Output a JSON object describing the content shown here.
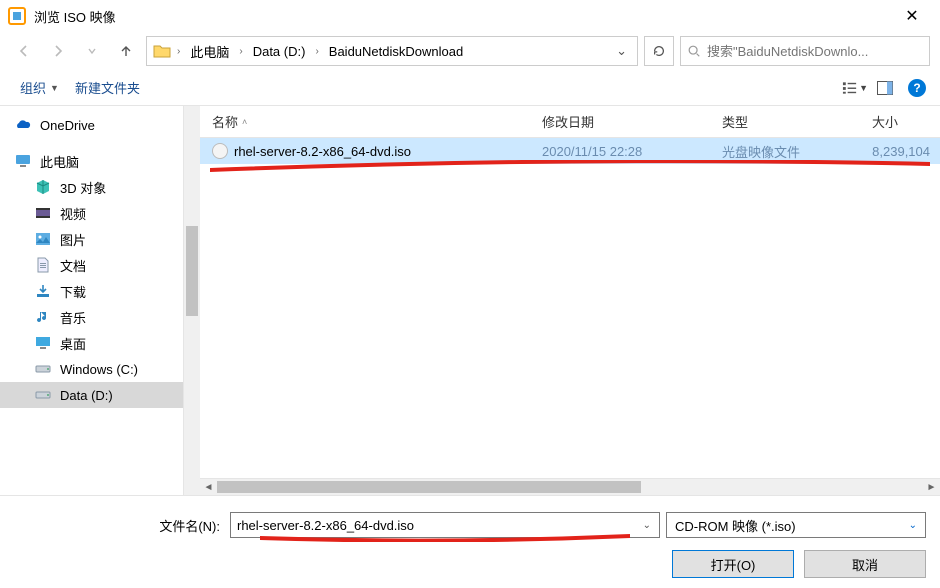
{
  "window": {
    "title": "浏览 ISO 映像"
  },
  "breadcrumb": {
    "items": [
      "此电脑",
      "Data (D:)",
      "BaiduNetdiskDownload"
    ]
  },
  "search": {
    "placeholder": "搜索\"BaiduNetdiskDownlo..."
  },
  "toolbar": {
    "organize": "组织",
    "newfolder": "新建文件夹"
  },
  "columns": {
    "name": "名称",
    "date": "修改日期",
    "type": "类型",
    "size": "大小"
  },
  "sidebar": {
    "onedrive": "OneDrive",
    "thispc": "此电脑",
    "items": [
      {
        "icon": "cube3d",
        "label": "3D 对象"
      },
      {
        "icon": "video",
        "label": "视频"
      },
      {
        "icon": "picture",
        "label": "图片"
      },
      {
        "icon": "doc",
        "label": "文档"
      },
      {
        "icon": "download",
        "label": "下载"
      },
      {
        "icon": "music",
        "label": "音乐"
      },
      {
        "icon": "desktop",
        "label": "桌面"
      },
      {
        "icon": "drive",
        "label": "Windows (C:)"
      },
      {
        "icon": "drive",
        "label": "Data (D:)"
      }
    ]
  },
  "files": [
    {
      "name": "rhel-server-8.2-x86_64-dvd.iso",
      "date": "2020/11/15 22:28",
      "type": "光盘映像文件",
      "size": "8,239,104"
    }
  ],
  "footer": {
    "filename_label": "文件名(N):",
    "filename_value": "rhel-server-8.2-x86_64-dvd.iso",
    "filter": "CD-ROM 映像 (*.iso)",
    "open": "打开(O)",
    "cancel": "取消"
  },
  "chart_data": null
}
